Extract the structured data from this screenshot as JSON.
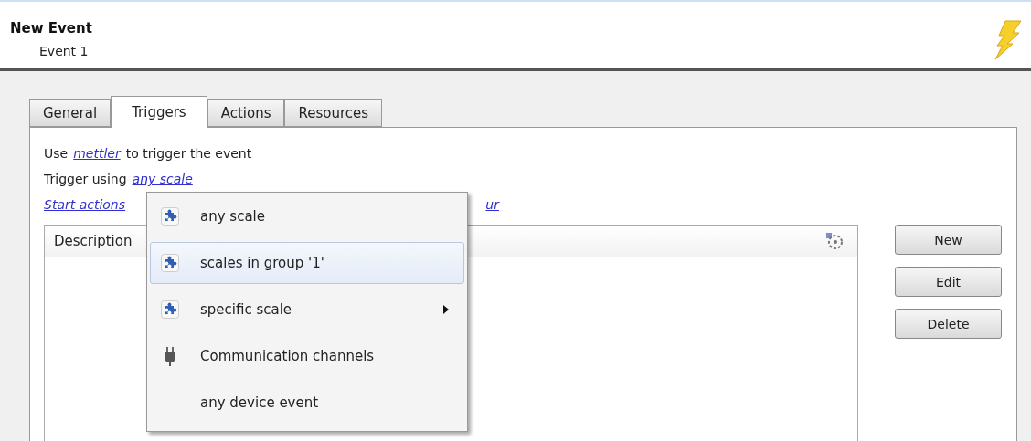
{
  "header": {
    "title": "New Event",
    "subtitle": "Event 1"
  },
  "tabs": [
    {
      "label": "General",
      "selected": false
    },
    {
      "label": "Triggers",
      "selected": true
    },
    {
      "label": "Actions",
      "selected": false
    },
    {
      "label": "Resources",
      "selected": false
    }
  ],
  "trigger_lines": [
    {
      "prefix": "Use",
      "link": "mettler",
      "suffix": "to trigger the event"
    },
    {
      "prefix": "Trigger using",
      "link": "any scale"
    }
  ],
  "actions_link": {
    "start": "Start actions",
    "end": "ur"
  },
  "list": {
    "columns": [
      "Description"
    ]
  },
  "buttons": [
    "New",
    "Edit",
    "Delete"
  ],
  "menu": [
    {
      "kind": "scale",
      "label": "any scale",
      "selected": false
    },
    {
      "kind": "scale",
      "label": "scales in group '1'",
      "selected": true
    },
    {
      "kind": "scale",
      "label": "specific scale",
      "selected": false,
      "submenu": true
    },
    {
      "kind": "channel",
      "label": "Communication channels",
      "selected": false
    },
    {
      "kind": "event",
      "label": "any device event",
      "selected": false
    }
  ]
}
